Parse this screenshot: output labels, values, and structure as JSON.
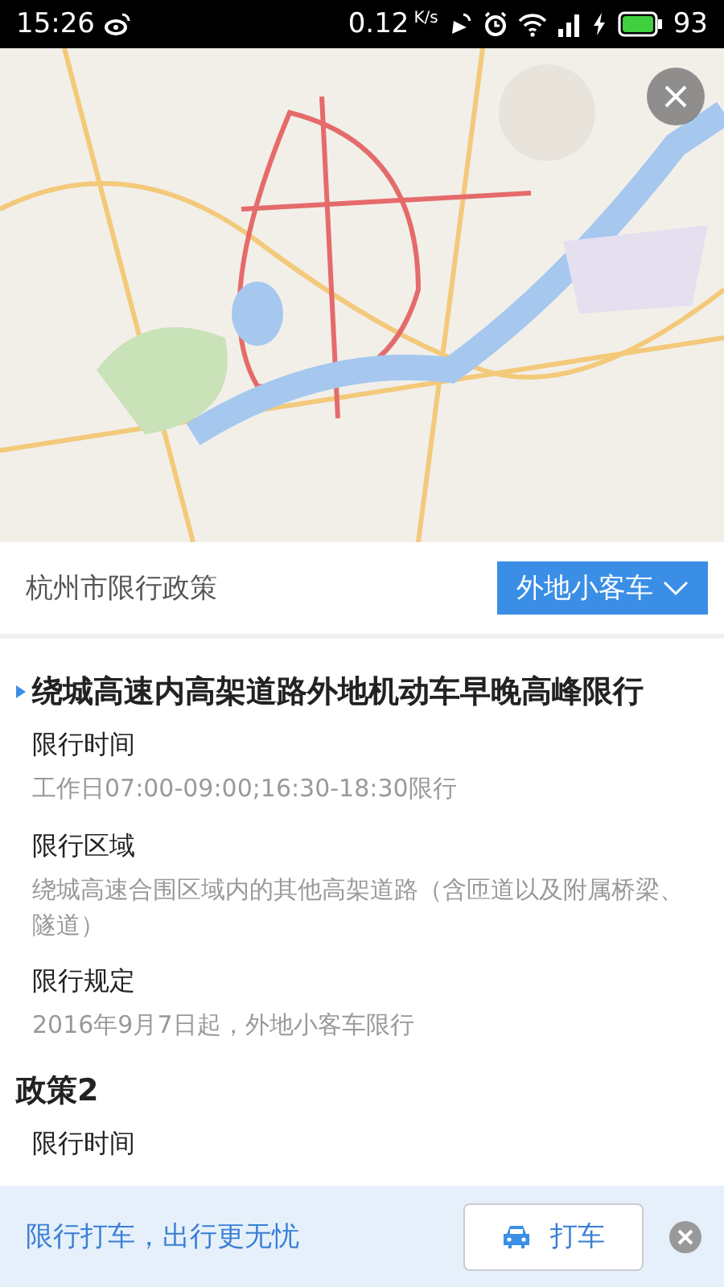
{
  "status_bar": {
    "time": "15:26",
    "speed": "0.12",
    "speed_unit": "K/s",
    "battery": "93"
  },
  "header": {
    "title": "杭州市限行政策",
    "vehicle_dropdown": "外地小客车"
  },
  "policies": [
    {
      "title": "绕城高速内高架道路外地机动车早晚高峰限行",
      "marked": true,
      "sections": [
        {
          "label": "限行时间",
          "value": "工作日07:00-09:00;16:30-18:30限行"
        },
        {
          "label": "限行区域",
          "value": "绕城高速合围区域内的其他高架道路（含匝道以及附属桥梁、隧道）"
        },
        {
          "label": "限行规定",
          "value": "2016年9月7日起，外地小客车限行"
        }
      ]
    },
    {
      "title": "政策2",
      "marked": false,
      "sections": [
        {
          "label": "限行时间"
        }
      ]
    }
  ],
  "banner": {
    "text": "限行打车，出行更无忧",
    "button": "打车"
  }
}
